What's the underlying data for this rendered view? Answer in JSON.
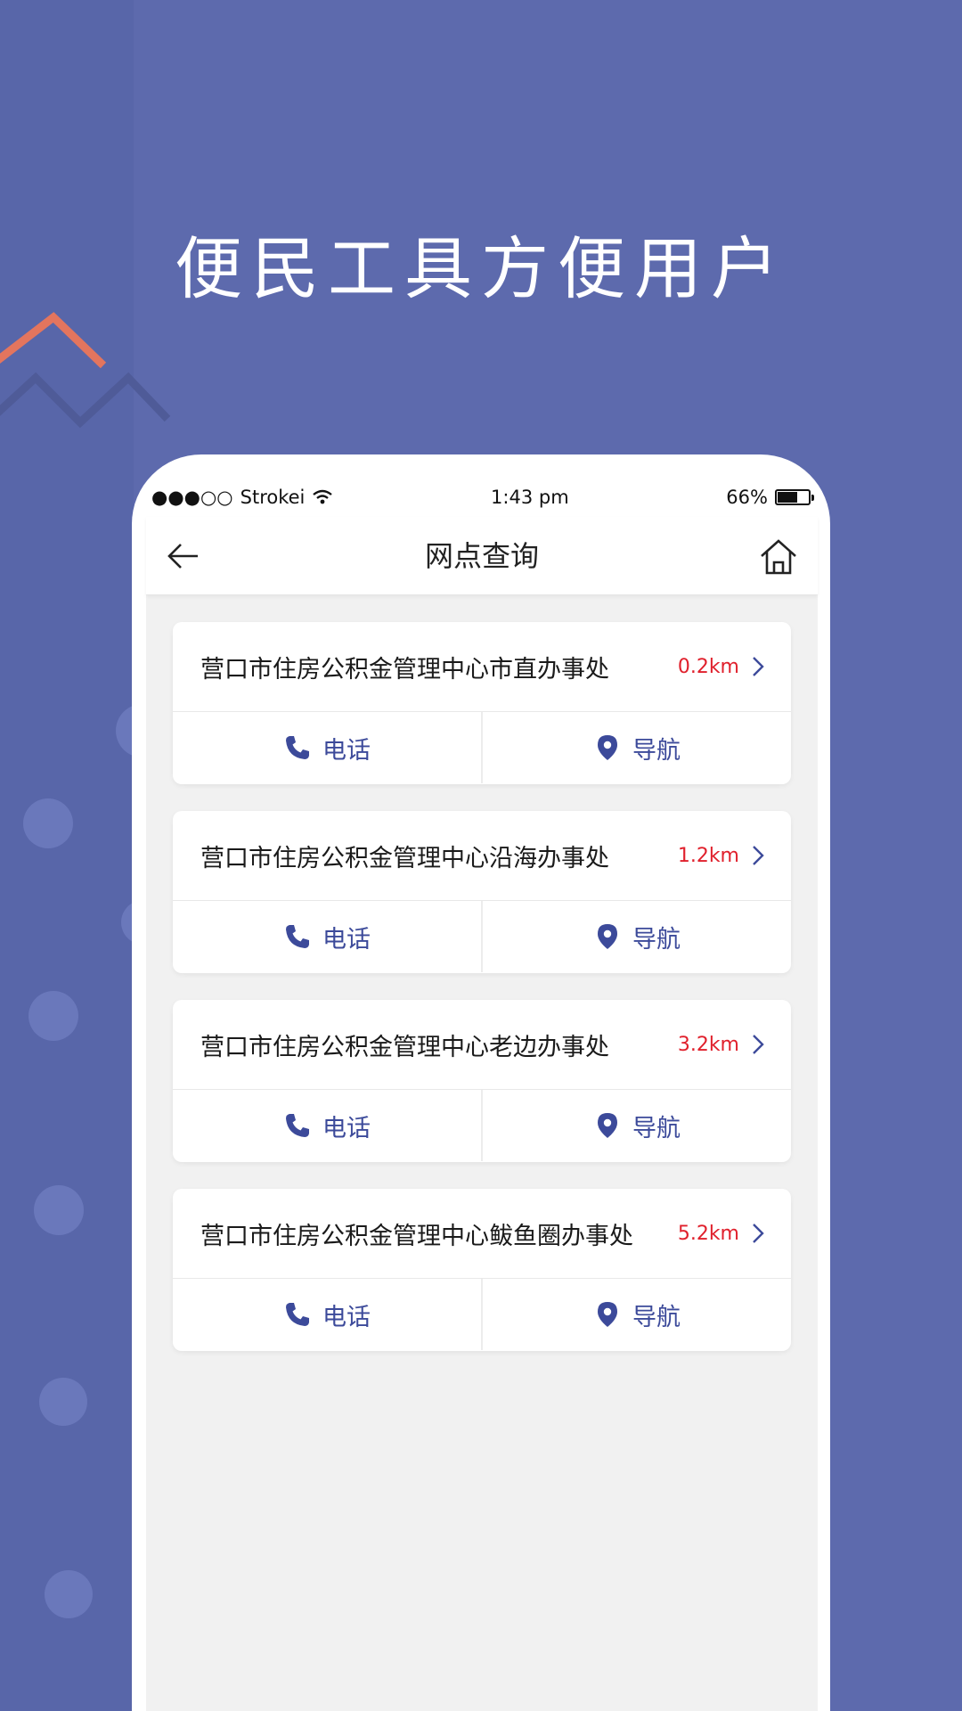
{
  "colors": {
    "background": "#5d6aad",
    "accent": "#3c4a9a",
    "distance": "#e0202c",
    "zigzag_orange": "#e3755e"
  },
  "tagline": "便民工具方便用户",
  "status_bar": {
    "signal": "●●●○○",
    "carrier": "Strokei",
    "time": "1:43 pm",
    "battery_text": "66%",
    "battery_level": 0.66
  },
  "nav": {
    "title": "网点查询",
    "back_icon": "arrow-left-icon",
    "home_icon": "home-icon"
  },
  "offices": [
    {
      "name": "营口市住房公积金管理中心市直办事处",
      "distance": "0.2km",
      "call_label": "电话",
      "nav_label": "导航"
    },
    {
      "name": "营口市住房公积金管理中心沿海办事处",
      "distance": "1.2km",
      "call_label": "电话",
      "nav_label": "导航"
    },
    {
      "name": "营口市住房公积金管理中心老边办事处",
      "distance": "3.2km",
      "call_label": "电话",
      "nav_label": "导航"
    },
    {
      "name": "营口市住房公积金管理中心鲅鱼圈办事处",
      "distance": "5.2km",
      "call_label": "电话",
      "nav_label": "导航"
    }
  ]
}
